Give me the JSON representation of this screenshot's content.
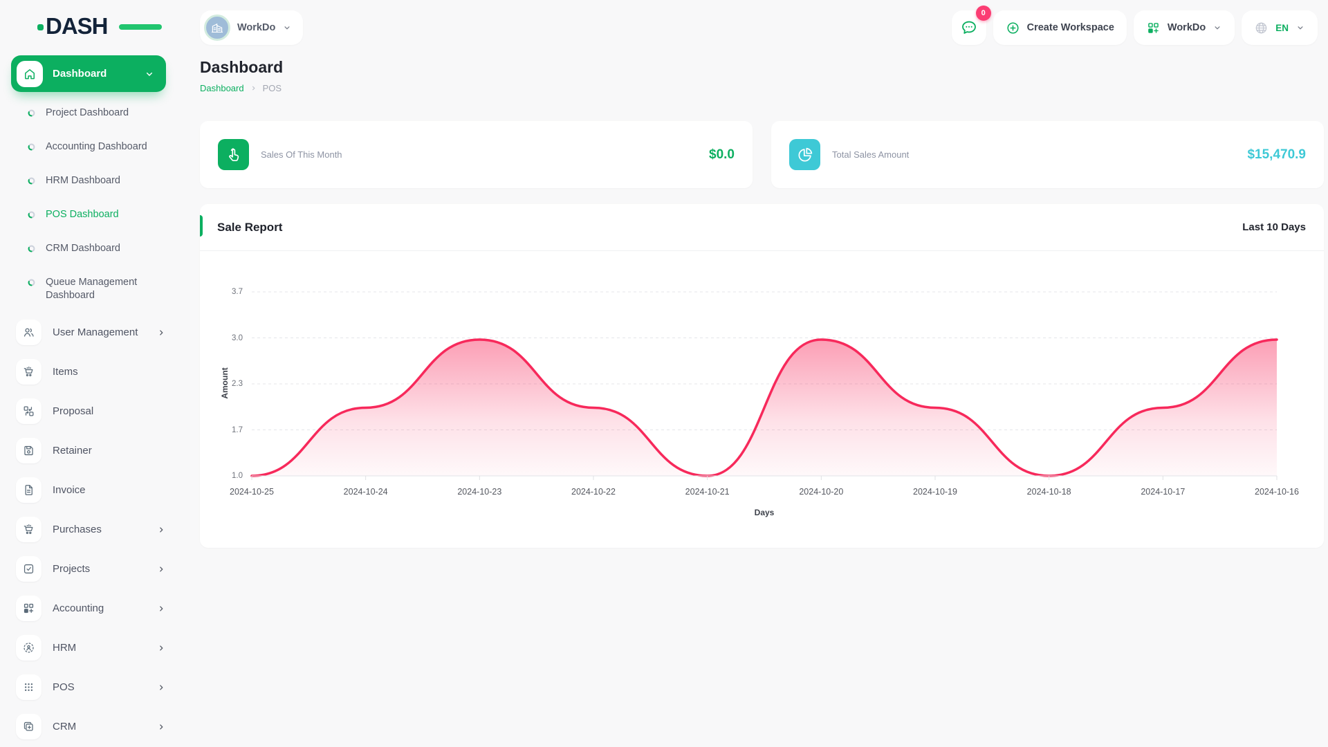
{
  "brand": {
    "logo_text": "DASH"
  },
  "topbar": {
    "workspace_switcher": {
      "label": "WorkDo",
      "avatar_icon": "building-icon"
    },
    "messages": {
      "icon": "chat-bubble-icon",
      "badge_count": "0"
    },
    "create_workspace": {
      "label": "Create Workspace",
      "icon": "plus-circle-icon"
    },
    "workdo_menu": {
      "label": "WorkDo",
      "icon": "grid-plus-icon"
    },
    "language": {
      "label": "EN",
      "icon": "globe-icon"
    }
  },
  "sidebar": {
    "dashboard_group": {
      "label": "Dashboard",
      "icon": "home-icon",
      "expanded": true
    },
    "dashboard_items": [
      {
        "label": "Project Dashboard",
        "active": false
      },
      {
        "label": "Accounting Dashboard",
        "active": false
      },
      {
        "label": "HRM Dashboard",
        "active": false
      },
      {
        "label": "POS Dashboard",
        "active": true
      },
      {
        "label": "CRM Dashboard",
        "active": false
      },
      {
        "label": "Queue Management Dashboard",
        "active": false
      }
    ],
    "menu_items": [
      {
        "label": "User Management",
        "icon": "users-icon",
        "has_submenu": true
      },
      {
        "label": "Items",
        "icon": "cart-icon",
        "has_submenu": false
      },
      {
        "label": "Proposal",
        "icon": "swap-boxes-icon",
        "has_submenu": false
      },
      {
        "label": "Retainer",
        "icon": "floppy-disk-icon",
        "has_submenu": false
      },
      {
        "label": "Invoice",
        "icon": "document-icon",
        "has_submenu": false
      },
      {
        "label": "Purchases",
        "icon": "cart-icon",
        "has_submenu": true
      },
      {
        "label": "Projects",
        "icon": "checkbox-icon",
        "has_submenu": true
      },
      {
        "label": "Accounting",
        "icon": "grid-plus-icon",
        "has_submenu": true
      },
      {
        "label": "HRM",
        "icon": "person-focus-icon",
        "has_submenu": true
      },
      {
        "label": "POS",
        "icon": "dots-grid-icon",
        "has_submenu": true
      },
      {
        "label": "CRM",
        "icon": "squares-plus-icon",
        "has_submenu": true
      }
    ]
  },
  "page": {
    "title": "Dashboard",
    "breadcrumb": {
      "root": "Dashboard",
      "current": "POS"
    }
  },
  "stats": [
    {
      "label": "Sales Of This Month",
      "value": "$0.0",
      "accent_color": "#0CAF60",
      "icon": "tap-icon"
    },
    {
      "label": "Total Sales Amount",
      "value": "$15,470.9",
      "accent_color": "#3EC9D6",
      "icon": "pie-chart-icon"
    }
  ],
  "sale_report": {
    "title": "Sale Report",
    "range_label": "Last 10 Days"
  },
  "chart_data": {
    "type": "area",
    "title": "Sale Report",
    "x": [
      "2024-10-25",
      "2024-10-24",
      "2024-10-23",
      "2024-10-22",
      "2024-10-21",
      "2024-10-20",
      "2024-10-19",
      "2024-10-18",
      "2024-10-17",
      "2024-10-16"
    ],
    "values": [
      1.0,
      2.0,
      3.0,
      2.0,
      1.0,
      3.0,
      2.0,
      1.0,
      2.0,
      3.0
    ],
    "xlabel": "Days",
    "ylabel": "Amount",
    "ylim": [
      1.0,
      3.7
    ],
    "yticks": [
      "3.7",
      "3.0",
      "2.3",
      "1.7",
      "1.0"
    ],
    "grid": "horizontal-dashed",
    "legend": "none",
    "line_color": "#F7295B",
    "fill": "pink-gradient-to-transparent"
  },
  "colors": {
    "primary": "#0CAF60",
    "teal": "#3EC9D6",
    "chart_line": "#F7295B",
    "badge": "#FB3D73"
  }
}
